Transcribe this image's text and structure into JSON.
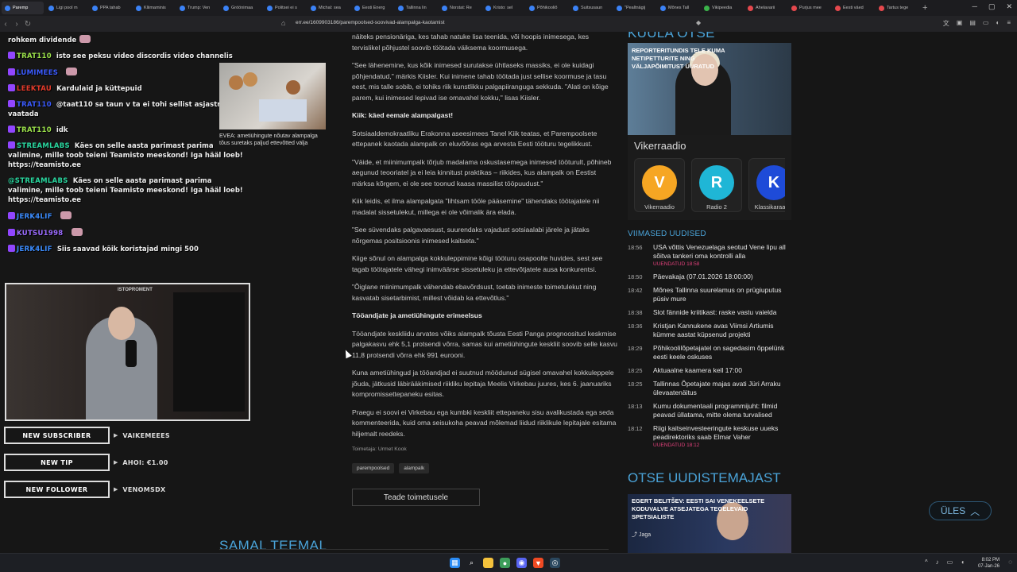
{
  "browser": {
    "tabs": [
      {
        "label": "Paremp",
        "color": "#3b82f6",
        "active": true
      },
      {
        "label": "Ligi pool m",
        "color": "#3b82f6"
      },
      {
        "label": "PPA tahab",
        "color": "#3b82f6"
      },
      {
        "label": "Kliimaminis",
        "color": "#3b82f6"
      },
      {
        "label": "Trump: Ven",
        "color": "#3b82f6"
      },
      {
        "label": "Gröönimaa",
        "color": "#3b82f6"
      },
      {
        "label": "Politsei ei s",
        "color": "#3b82f6"
      },
      {
        "label": "Michal: sea",
        "color": "#3b82f6"
      },
      {
        "label": "Eesti Energ",
        "color": "#3b82f6"
      },
      {
        "label": "Tallinna lin",
        "color": "#3b82f6"
      },
      {
        "label": "Norstat: Re",
        "color": "#3b82f6"
      },
      {
        "label": "Kristo: sel",
        "color": "#3b82f6"
      },
      {
        "label": "Põhikooliõ",
        "color": "#3b82f6"
      },
      {
        "label": "Suitsusaun",
        "color": "#3b82f6"
      },
      {
        "label": "\"Pealtnägij",
        "color": "#3b82f6"
      },
      {
        "label": "Mõnes Tall",
        "color": "#3b82f6"
      },
      {
        "label": "Vikipeedia",
        "color": "#3bb34a"
      },
      {
        "label": "Ahelavarii",
        "color": "#e5484d"
      },
      {
        "label": "Purjus mee",
        "color": "#e5484d"
      },
      {
        "label": "Eesti väed",
        "color": "#e5484d"
      },
      {
        "label": "Tartus tege",
        "color": "#e5484d"
      }
    ],
    "new_tab": "+",
    "url": "err.ee/1609903186/parempoolsed-soovivad-alampalga-kaotamist"
  },
  "chat": {
    "lines": [
      {
        "user": "",
        "text": "rohkem dividende",
        "user_color": "#eee",
        "emote": true
      },
      {
        "user": "TRAT110",
        "text": "isto see peksu video discordis video channelis",
        "user_color": "#9be24a",
        "badge": true
      },
      {
        "user": "LUMIMEES",
        "text": "",
        "user_color": "#3b5bff",
        "badge": true,
        "emote": true
      },
      {
        "user": "LEEKTAU",
        "text": "Kardulaid ja küttepuid",
        "user_color": "#e33b2b",
        "badge": true
      },
      {
        "user": "TRAT110",
        "text": "@taat110 sa taun v ta ei tohi sellist asjastriimis vaatada",
        "user_color": "#3b5bff",
        "badge": true,
        "wrap": true
      },
      {
        "user": "TRAT110",
        "text": "idk",
        "user_color": "#9be24a",
        "badge": true
      },
      {
        "user": "STREAMLABS",
        "text": "Käes on selle aasta parimast parima valimine, mille toob teieni Teamisto meeskond! Iga hääl loeb! https://teamisto.ee",
        "user_color": "#2ad8a0",
        "badge": true
      },
      {
        "user": "@STREAMLABS",
        "text": "Käes on selle aasta parimast parima valimine, mille toob teieni Teamisto meeskond! Iga hääl loeb! https://teamisto.ee",
        "user_color": "#2ad8a0",
        "badge": false
      },
      {
        "user": "JERK4LIF",
        "text": "",
        "user_color": "#3b8cff",
        "badge": true,
        "emote": true
      },
      {
        "user": "KUTSU1998",
        "text": "",
        "user_color": "#9b6bff",
        "badge": true,
        "emote": true
      },
      {
        "user": "JERK4LIF",
        "text": "Siis saavad kõik koristajad mingi 500",
        "user_color": "#3b8cff",
        "badge": true
      }
    ]
  },
  "thumb": {
    "caption": "EVEA: ametiühingute nõutav alampalga tõus suretaks paljud ettevõtted välja"
  },
  "webcam": {
    "sign": "ISTOPROMENT"
  },
  "alerts": [
    {
      "label": "NEW SUBSCRIBER",
      "value": "VAIKEMEEES"
    },
    {
      "label": "NEW TIP",
      "value": "AHOI: €1.00"
    },
    {
      "label": "NEW FOLLOWER",
      "value": "VENOMSDX"
    }
  ],
  "article": {
    "paragraphs": [
      {
        "text": "näiteks pensionäriga, kes tahab natuke lisa teenida, või hoopis inimesega, kes tervislikel põhjustel soovib töötada väiksema koormusega.",
        "h": false
      },
      {
        "text": "\"See lähenemine, kus kõik inimesed surutakse ühtlaseks massiks, ei ole kuidagi põhjendatud,\" märkis Kiisler. Kui inimene tahab töötada just sellise koormuse ja tasu eest, mis talle sobib, ei tohiks riik kunstlikku palgapiiranguga sekkuda. \"Alati on kõige parem, kui inimesed lepivad ise omavahel kokku,\" lisas Kiisler.",
        "h": false
      },
      {
        "text": "Kiik: käed eemale alampalgast!",
        "h": true
      },
      {
        "text": "Sotsiaaldemokraatliku Erakonna aseesimees Tanel Kiik teatas, et Parempoolsete ettepanek kaotada alampalk on eluvõõras ega arvesta Eesti tööturu tegelikkust.",
        "h": false
      },
      {
        "text": "\"Väide, et miinimumpalk tõrjub madalama oskustasemega inimesed tööturult, põhineb aegunud teooriatel ja ei leia kinnitust praktikas – riikides, kus alampalk on Eestist märksa kõrgem, ei ole see toonud kaasa massilist tööpuudust.\"",
        "h": false
      },
      {
        "text": "Kiik leidis, et ilma alampalgata \"lihtsam tööle pääsemine\" tähendaks töötajatele nii madalat sissetulekut, millega ei ole võimalik ära elada.",
        "h": false
      },
      {
        "text": "\"See süvendaks palgavaesust, suurendaks vajadust sotsiaalabi järele ja jätaks nõrgemas positsioonis inimesed kaitseta.\"",
        "h": false
      },
      {
        "text": "Kiige sõnul on alampalga kokkuleppimine kõigi tööturu osapoolte huvides, sest see tagab töötajatele vähegi inimväärse sissetuleku ja ettevõtjatele ausa konkurentsi.",
        "h": false
      },
      {
        "text": "\"Õiglane miinimumpalk vähendab ebavõrdsust, toetab inimeste toimetulekut ning kasvatab sisetarbimist, millest võidab ka ettevõtlus.\"",
        "h": false
      },
      {
        "text": "Tööandjate ja ametiühingute erimeelsus",
        "h": true
      },
      {
        "text": "Tööandjate keskliidu arvates võiks alampalk tõusta Eesti Panga prognoositud keskmise palgakasvu ehk 5,1 protsendi võrra, samas kui ametiühingute keskliit soovib selle kasvu 11,8 protsendi võrra ehk 991 eurooni.",
        "h": false
      },
      {
        "text": "Kuna ametiühingud ja tööandjad ei suutnud möödunud sügisel omavahel kokkuleppele jõuda, jätkusid läbirääkimised riikliku lepitaja Meelis Virkebau juures, kes 6. jaanuariks kompromissettepaneku esitas.",
        "h": false
      },
      {
        "text": "Praegu ei soovi ei Virkebau ega kumbki keskliit ettepaneku sisu avalikustada ega seda kommenteerida, kuid oma seisukoha peavad mõlemad liidud riiklikule lepitajale esitama hiljemalt reedeks.",
        "h": false
      }
    ],
    "editor": "Toimetaja: Urmet Kook",
    "tags": [
      "parempoolsed",
      "alampalk"
    ],
    "send_label": "Teade toimetusele",
    "related_title": "SAMAL TEEMAL"
  },
  "right": {
    "top_title": "KUULA OTSE",
    "live_caption": "REPORTERITUNDIS TELE KUMA NETIPETTURITE NING VÄLJAPÕIMITUST ÜURATUD",
    "radio_name": "Vikerraadio",
    "stations": [
      {
        "name": "Vikerraadio",
        "color": "#f6a623",
        "glyph": "V"
      },
      {
        "name": "Radio 2",
        "color": "#1fb6d6",
        "glyph": "R"
      },
      {
        "name": "Klassikaraadio",
        "color": "#1e4bd8",
        "glyph": "K"
      }
    ],
    "latest_title": "VIIMASED UUDISED",
    "news": [
      {
        "time": "18:56",
        "text": "USA võttis Venezuelaga seotud Vene lipu all sõitva tankeri oma kontrolli alla",
        "updated": "UUENDATUD 18:58"
      },
      {
        "time": "18:50",
        "text": "Päevakaja (07.01.2026 18:00:00)",
        "updated": ""
      },
      {
        "time": "18:42",
        "text": "Mõnes Tallinna suurelamus on prügiuputus püsiv mure",
        "updated": ""
      },
      {
        "time": "18:38",
        "text": "Slot fännide kriitikast: raske vastu vaielda",
        "updated": ""
      },
      {
        "time": "18:36",
        "text": "Kristjan Kannukene avas Viimsi Artiumis kümme aastat küpsenud projekti",
        "updated": ""
      },
      {
        "time": "18:29",
        "text": "Põhikoolilõpetajatel on sagedasim õppelünk eesti keele oskuses",
        "updated": ""
      },
      {
        "time": "18:25",
        "text": "Aktuaalne kaamera kell 17:00",
        "updated": ""
      },
      {
        "time": "18:25",
        "text": "Tallinnas Õpetajate majas avati Jüri Arraku ülevaatenäitus",
        "updated": ""
      },
      {
        "time": "18:13",
        "text": "Kumu dokumentaali programmijuht: filmid peavad üllatama, mitte olema turvalised",
        "updated": ""
      },
      {
        "time": "18:12",
        "text": "Riigi kaitseinvesteeringute keskuse uueks peadirektoriks saab Elmar Vaher",
        "updated": "UUENDATUD 18:12"
      }
    ],
    "studio_title": "OTSE UUDISTEMAJAST",
    "studio_caption": "EGERT BELITŠEV: EESTI SAI VENEKEELSETE KODUVALVE ATSEJATEGA TEGELEVAID SPETSIALISTE",
    "share_label": "Jaga"
  },
  "ules_label": "ÜLES",
  "taskbar": {
    "time": "8:02 PM",
    "date": "07-Jan-26"
  }
}
